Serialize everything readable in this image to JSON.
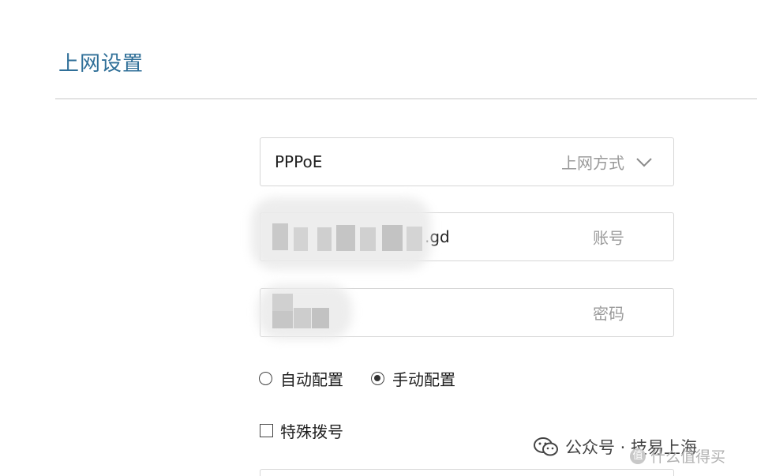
{
  "page": {
    "title": "上网设置"
  },
  "connection": {
    "value": "PPPoE",
    "label": "上网方式",
    "icon": "chevron-down-icon"
  },
  "account": {
    "value_visible": ".gd",
    "label": "账号"
  },
  "password": {
    "label": "密码"
  },
  "config_mode": {
    "options": [
      {
        "label": "自动配置",
        "checked": false
      },
      {
        "label": "手动配置",
        "checked": true
      }
    ]
  },
  "special_dial": {
    "label": "特殊拨号",
    "checked": false
  },
  "watermark": {
    "text": "公众号 · 技易上海",
    "icon": "wechat-icon",
    "site_text": "什么值得买",
    "site_icon": "zhi-icon"
  }
}
